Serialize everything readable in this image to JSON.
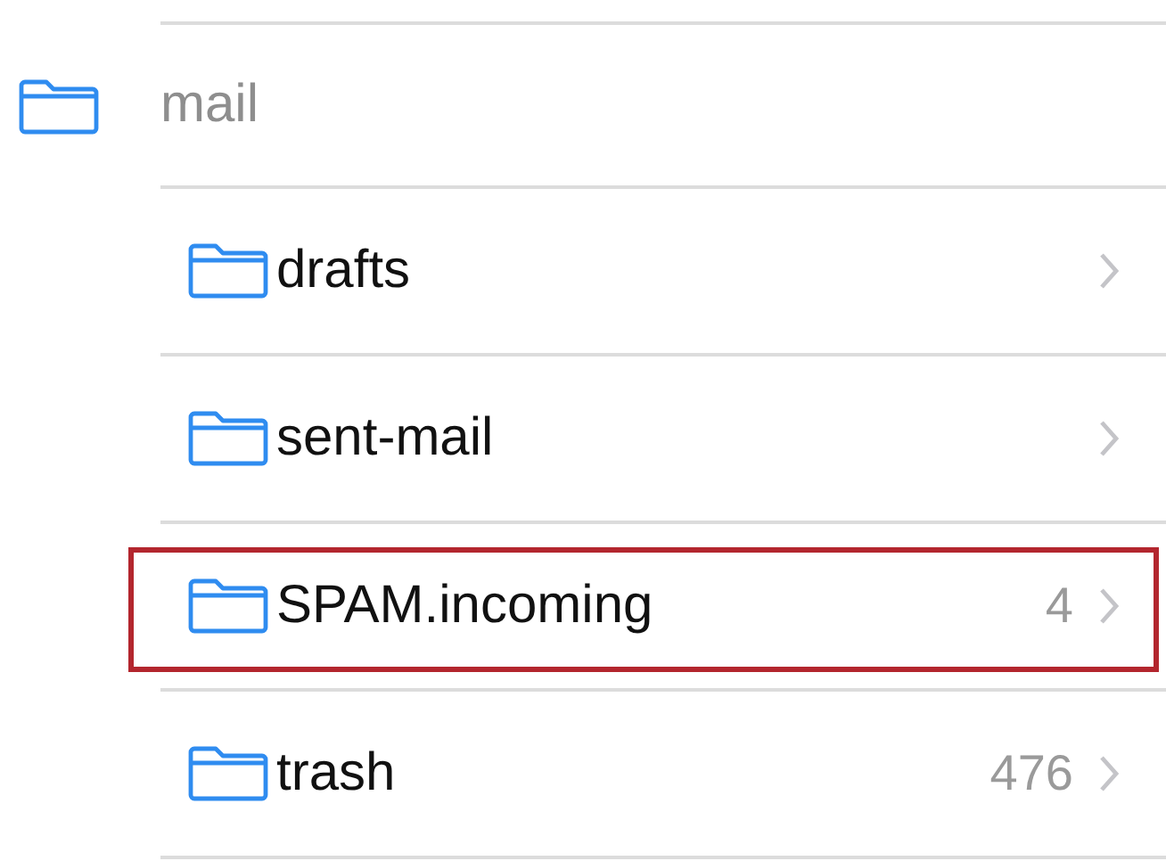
{
  "folder": {
    "name": "mail",
    "children": [
      {
        "name": "drafts",
        "highlighted": false
      },
      {
        "name": "sent-mail",
        "highlighted": false
      },
      {
        "name": "SPAM.incoming",
        "count": "4",
        "highlighted": true
      },
      {
        "name": "trash",
        "count": "476",
        "highlighted": false
      }
    ]
  }
}
